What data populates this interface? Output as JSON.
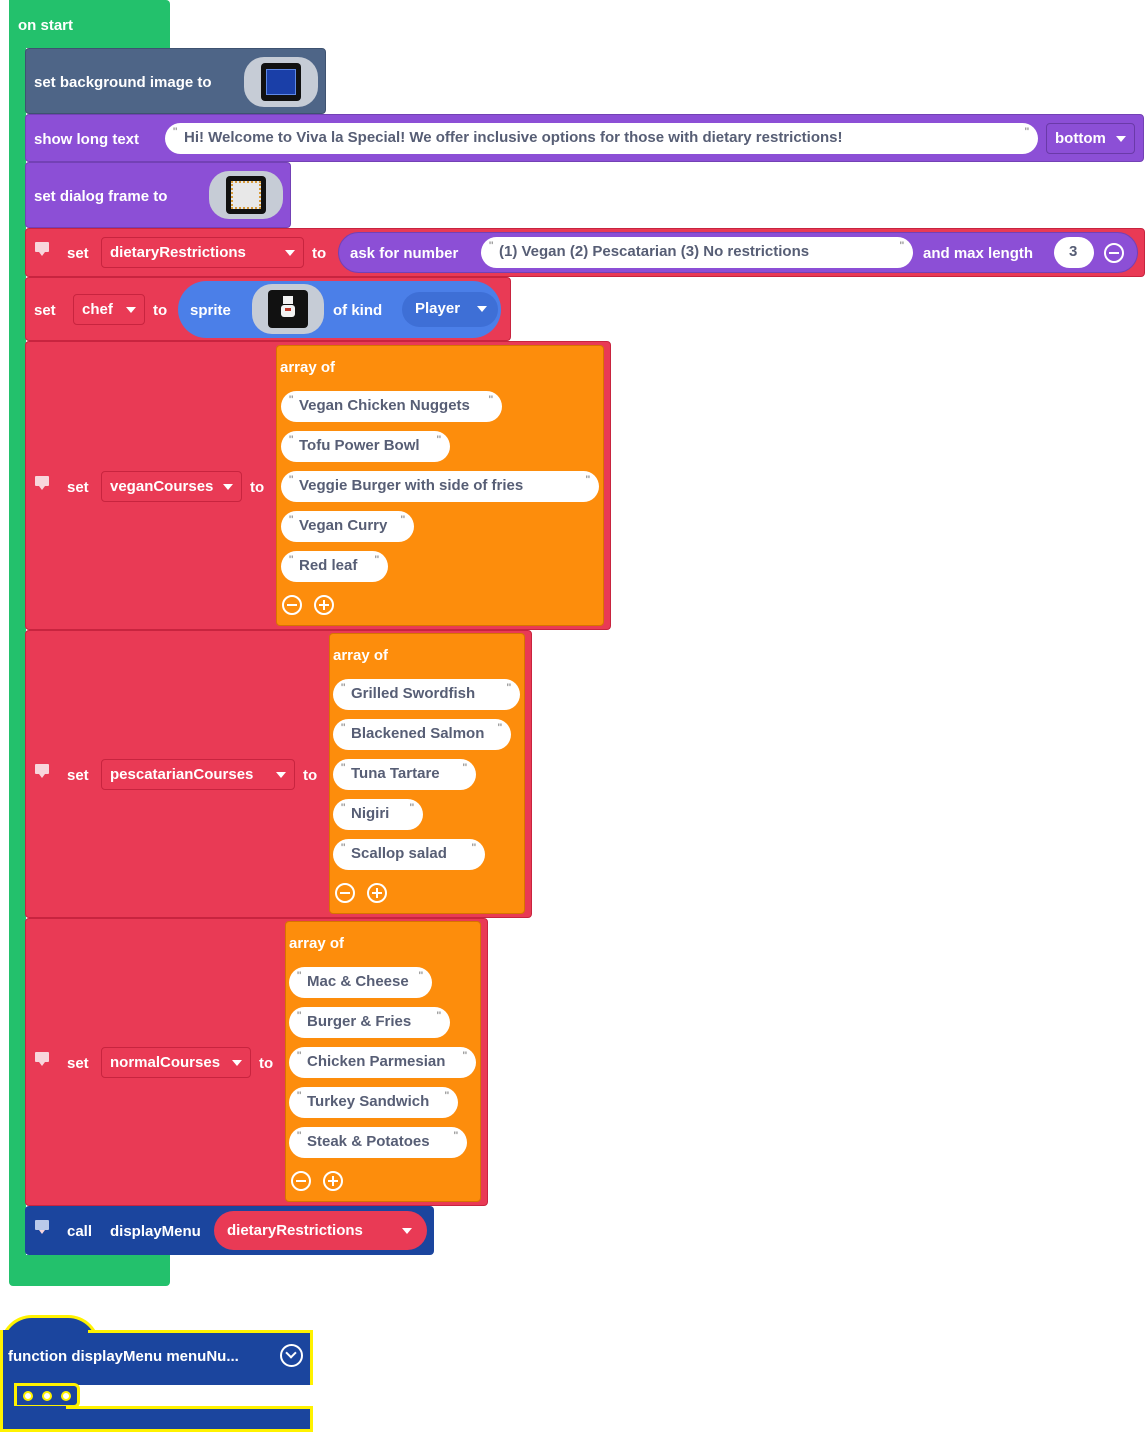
{
  "on_start": {
    "label": "on start"
  },
  "set_background": {
    "label": "set background image to",
    "image_icon": "background-image-thumbnail"
  },
  "show_long_text": {
    "label": "show long text",
    "text": "Hi! Welcome to Viva la Special! We offer inclusive options for those with dietary restrictions!",
    "position": "bottom"
  },
  "set_dialog_frame": {
    "label": "set dialog frame to",
    "image_icon": "dialog-frame-thumbnail"
  },
  "set_dietary": {
    "set_label": "set",
    "variable": "dietaryRestrictions",
    "to_label": "to",
    "ask_label": "ask for number",
    "prompt": "(1) Vegan (2) Pescatarian (3) No restrictions",
    "max_label": "and max length",
    "max_value": "3"
  },
  "set_chef": {
    "set_label": "set",
    "variable": "chef",
    "to_label": "to",
    "sprite_label": "sprite",
    "sprite_icon": "chef-sprite-thumbnail",
    "kind_label": "of kind",
    "kind": "Player"
  },
  "vegan": {
    "set_label": "set",
    "variable": "veganCourses",
    "to_label": "to",
    "array_label": "array of",
    "items": [
      "Vegan Chicken Nuggets",
      "Tofu Power Bowl",
      "Veggie Burger with side of fries",
      "Vegan Curry",
      "Red leaf"
    ]
  },
  "pescatarian": {
    "set_label": "set",
    "variable": "pescatarianCourses",
    "to_label": "to",
    "array_label": "array of",
    "items": [
      "Grilled Swordfish",
      "Blackened Salmon",
      "Tuna Tartare",
      "Nigiri",
      "Scallop salad"
    ]
  },
  "normal": {
    "set_label": "set",
    "variable": "normalCourses",
    "to_label": "to",
    "array_label": "array of",
    "items": [
      "Mac & Cheese",
      "Burger & Fries",
      "Chicken Parmesian",
      "Turkey Sandwich",
      "Steak & Potatoes"
    ]
  },
  "call_display": {
    "call_label": "call",
    "function_name": "displayMenu",
    "argument": "dietaryRestrictions"
  },
  "function_def": {
    "label": "function displayMenu menuNu..."
  },
  "colors": {
    "green": "#23c16c",
    "slate": "#4e6587",
    "purple": "#8c4fd6",
    "red": "#e93a55",
    "blue": "#4b7fe8",
    "navy": "#1b459e",
    "orange": "#fd8d0c",
    "highlight": "#fff200"
  }
}
